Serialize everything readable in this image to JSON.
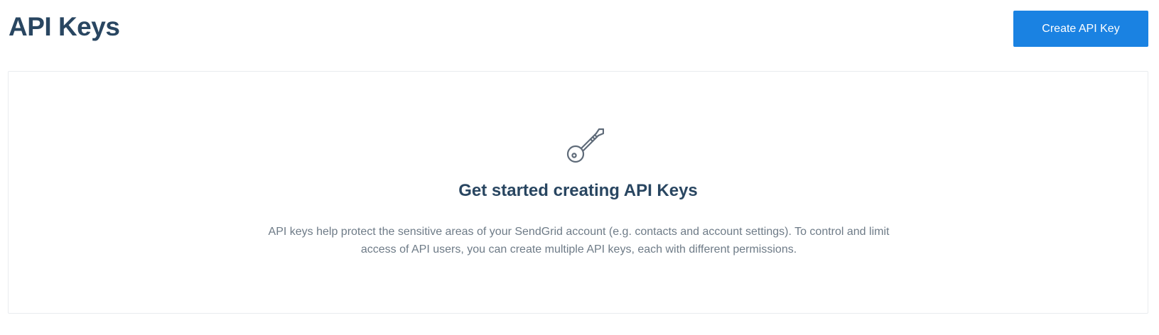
{
  "header": {
    "title": "API Keys",
    "create_button_label": "Create API Key"
  },
  "empty_state": {
    "icon": "key-icon",
    "title": "Get started creating API Keys",
    "description": "API keys help protect the sensitive areas of your SendGrid account (e.g. contacts and account settings). To control and limit access of API users, you can create multiple API keys, each with different permissions."
  },
  "colors": {
    "accent": "#1a82e2",
    "heading": "#294661",
    "body_text": "#6e7b87",
    "border": "#e9ecef"
  }
}
